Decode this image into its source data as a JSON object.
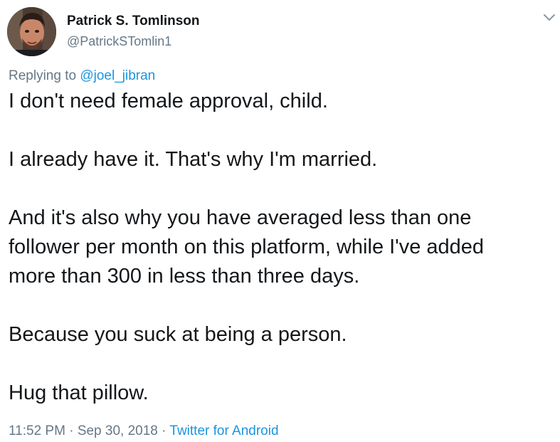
{
  "author": {
    "name": "Patrick S. Tomlinson",
    "handle": "@PatrickSTomlin1",
    "avatar_icon": "profile-photo"
  },
  "menu_icon": "chevron-down-icon",
  "reply": {
    "prefix": "Replying to ",
    "mention": "@joel_jibran"
  },
  "tweet": {
    "paragraphs": [
      [
        "I don't need female approval, child."
      ],
      [
        "I already have it. That's why I'm married."
      ],
      [
        "And it's also why you have averaged less than one",
        "follower per month on this platform, while I've added",
        "more than 300 in less than three days."
      ],
      [
        "Because you suck at being a person."
      ],
      [
        "Hug that pillow."
      ]
    ]
  },
  "meta": {
    "time": "11:52 PM",
    "separator": " · ",
    "date": "Sep 30, 2018",
    "source": "Twitter for Android"
  },
  "colors": {
    "text": "#14171a",
    "secondary": "#657786",
    "link": "#1b95e0"
  }
}
